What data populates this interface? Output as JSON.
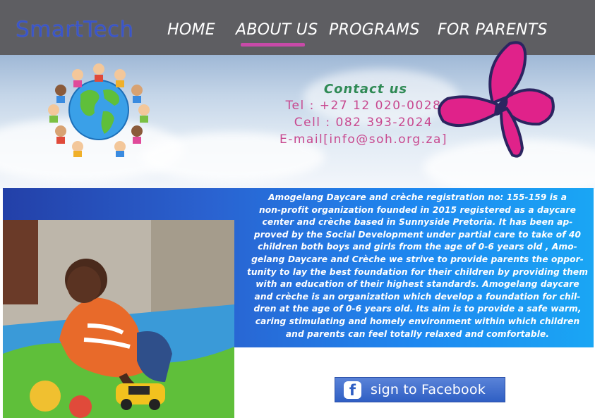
{
  "header": {
    "logo": "SmartTech",
    "nav": [
      {
        "label": "HOME"
      },
      {
        "label": "ABOUT US"
      },
      {
        "label": "PROGRAMS"
      },
      {
        "label": "FOR PARENTS"
      }
    ],
    "active_nav": "ABOUT US"
  },
  "contact": {
    "title": "Contact us",
    "tel": "Tel : +27 12 020-0028",
    "cell": "Cell : 082 393-2024",
    "email": "E-mail[info@soh.org.za]"
  },
  "about": {
    "lines": [
      "Amogelang Daycare and crèche registration no: 155-159 is a",
      "non-profit organization founded in 2015 registered as a daycare",
      "center and crèche based in Sunnyside Pretoria. It has been ap-",
      "proved by the Social Development under partial care to take of 40",
      "children both boys and girls from the age of 0-6 years old , Amo-",
      "gelang Daycare and Crèche we strive to provide parents the oppor-",
      "tunity to lay the best foundation for their children by providing them",
      "with an education of their highest standards. Amogelang daycare",
      "and crèche is an organization which develop a foundation for chil-",
      "dren at the age of 0-6 years old. Its aim is to provide a safe warm,",
      "caring stimulating and homely environment within which children",
      "and parents can feel totally relaxed and comfortable."
    ]
  },
  "facebook": {
    "icon": "f",
    "label": "sign to Facebook"
  },
  "colors": {
    "header_bg": "#5e5e62",
    "nav_underline": "#c84aa8",
    "contact_title": "#2f8a55",
    "contact_text": "#c8488f",
    "butterfly": "#e0228a",
    "facebook": "#2f5fc4"
  }
}
